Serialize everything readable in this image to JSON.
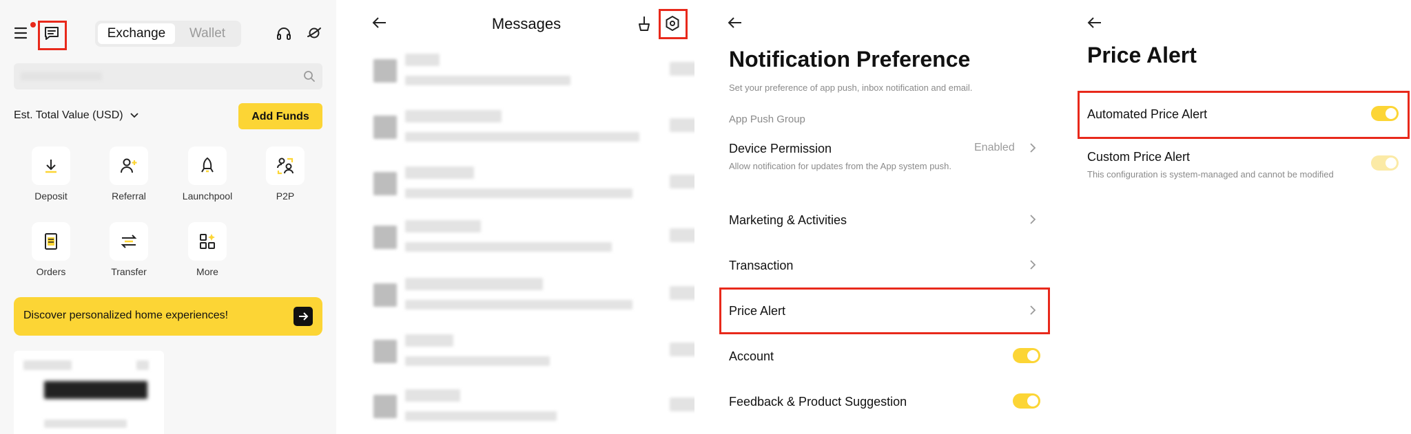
{
  "colors": {
    "accent": "#fcd535",
    "highlight": "#e8291b",
    "muted": "#8a8a8a"
  },
  "home": {
    "tabs": {
      "exchange": "Exchange",
      "wallet": "Wallet"
    },
    "est_value": "Est. Total Value (USD)",
    "add_funds": "Add Funds",
    "actions": [
      {
        "label": "Deposit",
        "icon": "download-icon"
      },
      {
        "label": "Referral",
        "icon": "add-user-icon"
      },
      {
        "label": "Launchpool",
        "icon": "rocket-icon"
      },
      {
        "label": "P2P",
        "icon": "p2p-icon"
      },
      {
        "label": "Orders",
        "icon": "document-icon"
      },
      {
        "label": "Transfer",
        "icon": "transfer-icon"
      },
      {
        "label": "More",
        "icon": "grid-icon"
      }
    ],
    "banner_text": "Discover personalized home experiences!"
  },
  "messages": {
    "title": "Messages"
  },
  "notif": {
    "title": "Notification Preference",
    "subtitle": "Set your preference of app push, inbox notification and email.",
    "section": "App Push Group",
    "device_permission": {
      "title": "Device Permission",
      "status": "Enabled",
      "desc": "Allow notification for updates from the App system push."
    },
    "items": {
      "marketing": "Marketing & Activities",
      "transaction": "Transaction",
      "price_alert": "Price Alert",
      "account": "Account",
      "feedback": "Feedback & Product Suggestion"
    }
  },
  "price_alert": {
    "title": "Price Alert",
    "automated": "Automated Price Alert",
    "custom": "Custom Price Alert",
    "custom_desc": "This configuration is system-managed and cannot be modified"
  }
}
